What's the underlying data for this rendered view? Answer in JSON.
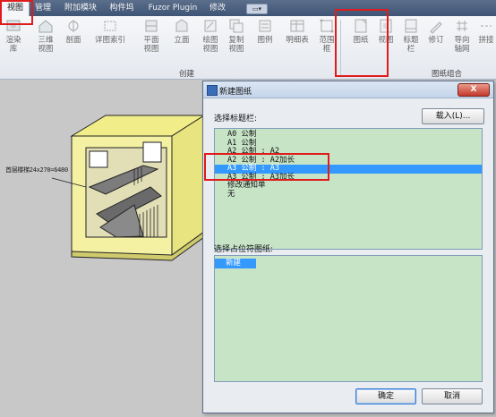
{
  "tabs": [
    {
      "label": "视图",
      "active": true
    },
    {
      "label": "管理",
      "active": false
    },
    {
      "label": "附加模块",
      "active": false
    },
    {
      "label": "构件坞",
      "active": false
    },
    {
      "label": "Fuzor Plugin",
      "active": false
    },
    {
      "label": "修改",
      "active": false
    }
  ],
  "ribbon": {
    "buttons": {
      "render_lib": "渲染\n库",
      "three_d": "三维\n视图",
      "section": "剖面",
      "detail_index": "详图索引",
      "plan_view": "平面\n视图",
      "elevation": "立面",
      "drafting_view": "绘图\n视图",
      "duplicate_view": "复制\n视图",
      "legend": "图例",
      "schedule": "明细表",
      "scope_box": "范围\n框",
      "sheet": "图纸",
      "view": "视图",
      "title_block": "标题\n栏",
      "revision": "修订",
      "guide_grid": "导向\n轴网",
      "matchline": "拼接"
    },
    "panel_create": "创建",
    "panel_sheet_comp": "图纸组合"
  },
  "viewport": {
    "annotation": "首层楼梯24x270=6480"
  },
  "dialog": {
    "title": "新建图纸",
    "close": "X",
    "select_titleblock_label": "选择标题栏:",
    "load_button": "载入(L)...",
    "titleblocks": [
      {
        "label": "A0 公制",
        "selected": false
      },
      {
        "label": "A1 公制",
        "selected": false
      },
      {
        "label": "A2 公制 : A2",
        "selected": false
      },
      {
        "label": "A2 公制 : A2加长",
        "selected": false
      },
      {
        "label": "A3 公制 : A3",
        "selected": true
      },
      {
        "label": "A3 公制 : A3加长",
        "selected": false
      },
      {
        "label": "修改通知单",
        "selected": false
      },
      {
        "label": "无",
        "selected": false
      }
    ],
    "select_placeholder_label": "选择占位符图纸:",
    "placeholders": [
      "新建"
    ],
    "ok_button": "确定",
    "cancel_button": "取消"
  },
  "colors": {
    "list_background": "#c7e4c7",
    "selection": "#3399ff",
    "highlight_box": "#e01b1b",
    "viewport_bg": "#c8c8c8",
    "model_yellow": "#f1ee8a"
  }
}
